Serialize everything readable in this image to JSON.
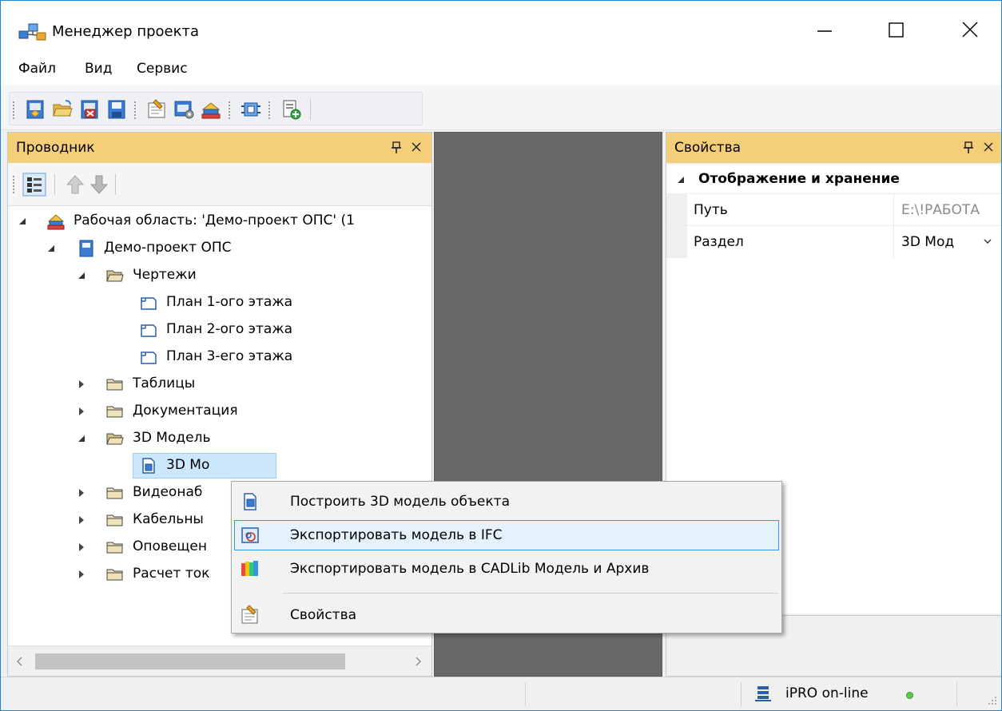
{
  "window": {
    "title": "Менеджер проекта",
    "accent": "#1883d7"
  },
  "menubar": {
    "items": [
      "Файл",
      "Вид",
      "Сервис"
    ]
  },
  "toolbar": {
    "buttons": [
      "new-project-icon",
      "open-folder-icon",
      "close-project-icon",
      "save-icon",
      "properties-icon",
      "settings-icon",
      "workspace-icon",
      "module-icon",
      "add-document-icon"
    ]
  },
  "explorer": {
    "title": "Проводник",
    "header_color": "#f5ce7a",
    "tree": [
      {
        "label": "Рабочая область: 'Демо-проект ОПС' (1",
        "icon": "workspace-icon",
        "expanded": true
      },
      {
        "label": "Демо-проект ОПС",
        "icon": "project-icon",
        "expanded": true
      },
      {
        "label": "Чертежи",
        "icon": "open-folder-icon",
        "expanded": true
      },
      {
        "label": "План 1-ого этажа",
        "icon": "drawing-icon"
      },
      {
        "label": "План 2-ого этажа",
        "icon": "drawing-icon"
      },
      {
        "label": "План 3-его этажа",
        "icon": "drawing-icon"
      },
      {
        "label": "Таблицы",
        "icon": "folder-icon",
        "expanded": false
      },
      {
        "label": "Документация",
        "icon": "folder-icon",
        "expanded": false
      },
      {
        "label": "3D Модель",
        "icon": "open-folder-icon",
        "expanded": true
      },
      {
        "label": "3D Мо",
        "icon": "model-document-icon",
        "selected": true
      },
      {
        "label": "Видеонаб",
        "icon": "folder-icon",
        "expanded": false
      },
      {
        "label": "Кабельны",
        "icon": "folder-icon",
        "expanded": false
      },
      {
        "label": "Оповещен",
        "icon": "folder-icon",
        "expanded": false
      },
      {
        "label": "Расчет ток",
        "icon": "folder-icon",
        "expanded": false
      }
    ]
  },
  "properties": {
    "title": "Свойства",
    "category": "Отображение и хранение",
    "rows": [
      {
        "name": "Путь",
        "value": "E:\\!РАБОТА"
      },
      {
        "name": "Раздел",
        "value": "3D Мод"
      }
    ]
  },
  "context_menu": {
    "items": [
      {
        "label": "Построить 3D модель объекта",
        "icon": "build-model-icon"
      },
      {
        "label": "Экспортировать модель в IFC",
        "icon": "ifc-export-icon",
        "highlighted": true
      },
      {
        "label": "Экспортировать модель в CADLib Модель и Архив",
        "icon": "cadlib-export-icon"
      },
      {
        "label": "Свойства",
        "icon": "properties-icon"
      }
    ]
  },
  "statusbar": {
    "service_text": "iPRO on-line",
    "status_color": "#5cc94e"
  }
}
